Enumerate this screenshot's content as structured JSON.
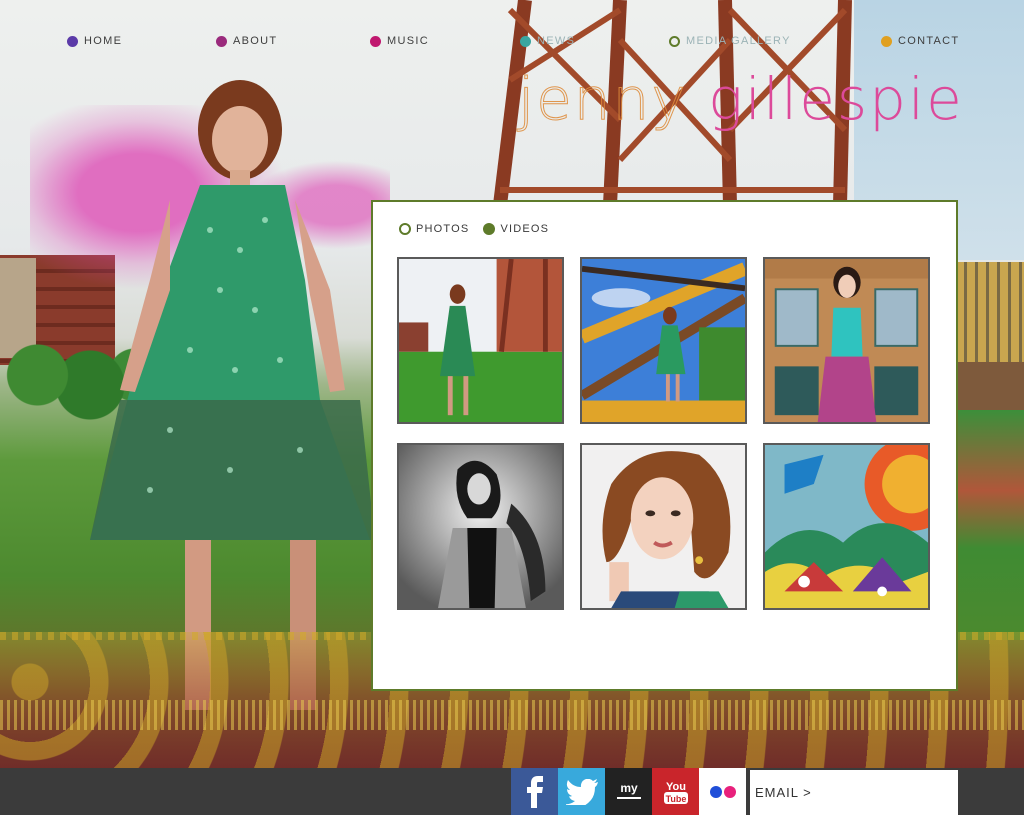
{
  "nav": {
    "items": [
      {
        "label": "HOME",
        "color": "#5b3aa8"
      },
      {
        "label": "ABOUT",
        "color": "#9a2a7c"
      },
      {
        "label": "MUSIC",
        "color": "#c0186f"
      },
      {
        "label": "NEWS",
        "color": "#3aa6a0"
      },
      {
        "label": "MEDIA GALLERY",
        "color": "#5e7b2a"
      },
      {
        "label": "CONTACT",
        "color": "#e0a020"
      }
    ]
  },
  "logo": {
    "first": "jenny",
    "last": "gillespie"
  },
  "gallery": {
    "tabs": [
      {
        "label": "PHOTOS"
      },
      {
        "label": "VIDEOS"
      }
    ],
    "accent": "#5e7b2a"
  },
  "footer": {
    "social": [
      {
        "label": "f",
        "icon": "facebook-icon"
      },
      {
        "label": "",
        "icon": "twitter-icon"
      },
      {
        "label": "my",
        "icon": "myspace-icon"
      },
      {
        "label": "You Tube",
        "icon": "youtube-icon"
      },
      {
        "label": "",
        "icon": "flickr-icon"
      }
    ],
    "email_label": "EMAIL >"
  }
}
